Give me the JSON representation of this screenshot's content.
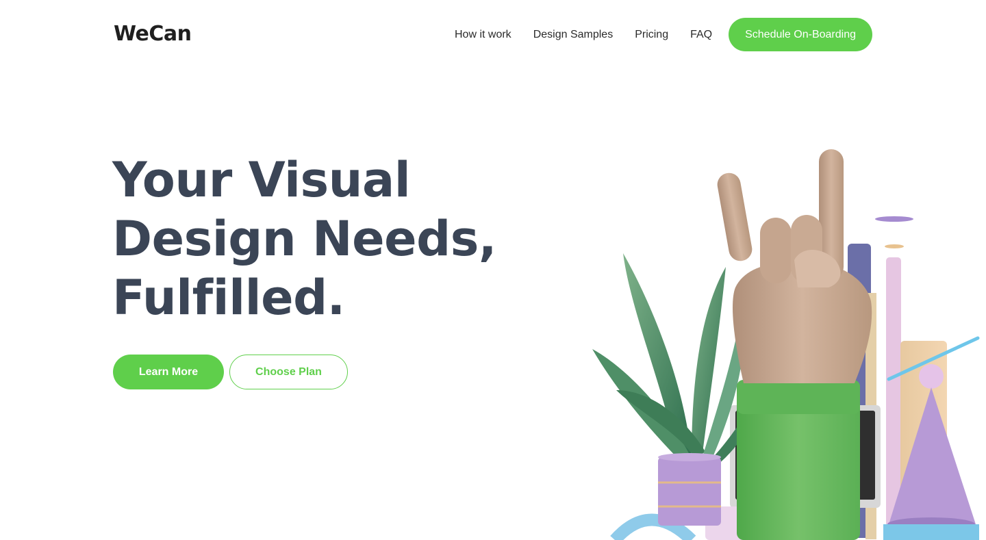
{
  "brand": {
    "logo_text": "WeCan"
  },
  "nav": {
    "links": [
      "How it work",
      "Design Samples",
      "Pricing",
      "FAQ"
    ],
    "cta_label": "Schedule On-Boarding"
  },
  "hero": {
    "title_lines": [
      "Your Visual",
      "Design Needs,",
      "Fulfilled."
    ],
    "primary_button": "Learn More",
    "secondary_button": "Choose Plan"
  },
  "colors": {
    "accent_green": "#5fcf4b",
    "heading": "#3b4556",
    "logo": "#1f1f1f"
  }
}
